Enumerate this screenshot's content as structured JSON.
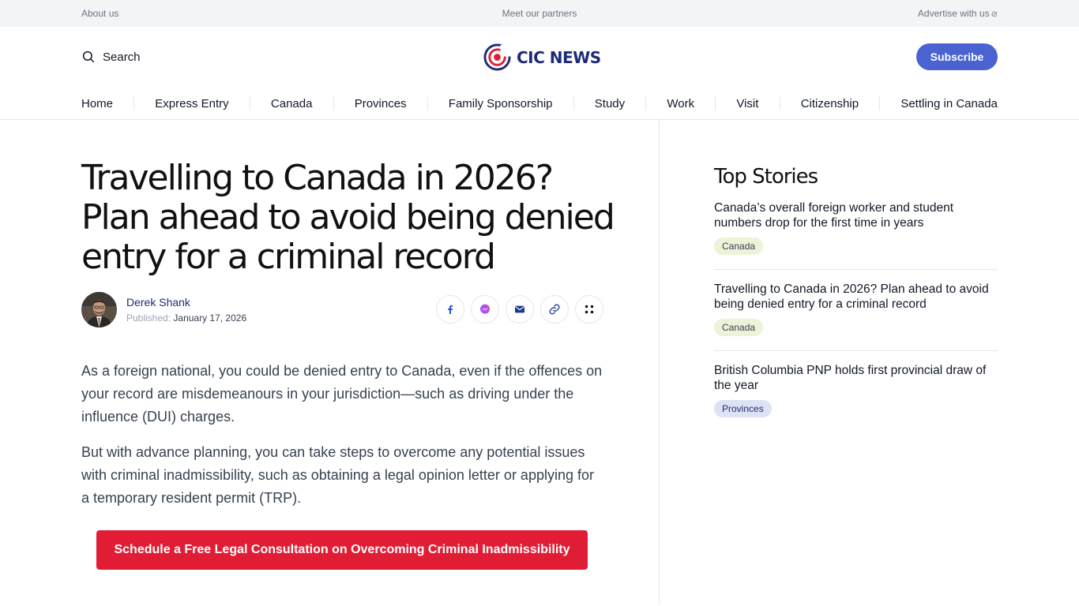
{
  "topbar": {
    "about": "About us",
    "partners": "Meet our partners",
    "advertise": "Advertise with us"
  },
  "header": {
    "search_label": "Search",
    "logo_text": "CIC NEWS",
    "subscribe_label": "Subscribe"
  },
  "nav": {
    "items": [
      "Home",
      "Express Entry",
      "Canada",
      "Provinces",
      "Family Sponsorship",
      "Study",
      "Work",
      "Visit",
      "Citizenship",
      "Settling in Canada"
    ]
  },
  "article": {
    "title": "Travelling to Canada in 2026? Plan ahead to avoid being denied entry for a criminal record",
    "author": "Derek Shank",
    "published_label": "Published:",
    "published_date": "January 17, 2026",
    "paragraphs": [
      "As a foreign national, you could be denied entry to Canada, even if the offences on your record are misdemeanours in your jurisdiction—such as driving under the influence (DUI) charges.",
      "But with advance planning, you can take steps to overcome any potential issues with criminal inadmissibility, such as obtaining a legal opinion letter or applying for a temporary resident permit (TRP)."
    ],
    "cta_label": "Schedule a Free Legal Consultation on Overcoming Criminal Inadmissibility"
  },
  "share_icons": [
    "facebook-icon",
    "messenger-icon",
    "mail-icon",
    "link-icon",
    "more-icon"
  ],
  "sidebar": {
    "heading": "Top Stories",
    "stories": [
      {
        "title": "Canada’s overall foreign worker and student numbers drop for the first time in years",
        "tag": "Canada"
      },
      {
        "title": "Travelling to Canada in 2026? Plan ahead to avoid being denied entry for a criminal record",
        "tag": "Canada"
      },
      {
        "title": "British Columbia PNP holds first provincial draw of the year",
        "tag": "Provinces"
      }
    ]
  },
  "colors": {
    "brand_navy": "#1e2a78",
    "subscribe_blue": "#4a63d1",
    "cta_red": "#e11d35",
    "tag_canada_bg": "#ecf3d9",
    "tag_provinces_bg": "#dde3f4"
  }
}
